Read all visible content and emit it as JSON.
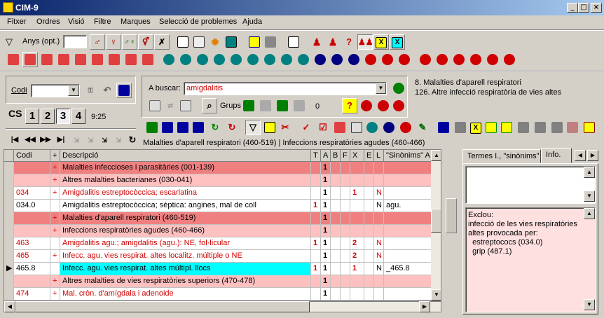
{
  "app": {
    "title": "CIM-9",
    "window_buttons": [
      "_",
      "□",
      "×"
    ]
  },
  "menu": [
    "Fitxer",
    "Ordres",
    "Visió",
    "Filtre",
    "Marques",
    "Selecció de problemes",
    "Ajuda"
  ],
  "filter": {
    "label": "Anys (opt.)",
    "value": ""
  },
  "codi": {
    "label": "Codi",
    "value": ""
  },
  "levels": [
    "CS",
    "1",
    "2",
    "3",
    "4"
  ],
  "time": "9:25",
  "search": {
    "label": "A buscar:",
    "value": "amigdalitis",
    "grups_label": "Grups",
    "count": "0"
  },
  "results": [
    "8. Malalties d'aparell respiratori",
    "126. Altre infecció respiratòria de vies altes"
  ],
  "breadcrumb": "Malalties d'aparell respiratori (460-519) | Infeccions respiratòries agudes (460-466)",
  "table": {
    "headers": [
      "Codi",
      "+",
      "Descripció",
      "T",
      "A",
      "B",
      "F",
      "X",
      "E",
      "L",
      "\"Sinònims\" A"
    ],
    "rows": [
      {
        "codi": "",
        "plus": "+",
        "desc": "Malalties infeccioses i parasitàries (001-139)",
        "T": "",
        "A": "1",
        "B": "",
        "F": "",
        "X": "",
        "E": "",
        "L": "",
        "syn": "",
        "style": "chapter"
      },
      {
        "codi": "",
        "plus": "+",
        "desc": "Altres malalties bacterianes (030-041)",
        "T": "",
        "A": "1",
        "B": "",
        "F": "",
        "X": "",
        "E": "",
        "L": "",
        "syn": "",
        "style": "group"
      },
      {
        "codi": "034",
        "plus": "+",
        "desc": "Amigdalitis estreptocòccica; escarlatina",
        "T": "",
        "A": "1",
        "B": "",
        "F": "",
        "X": "1",
        "E": "",
        "L": "N",
        "syn": "",
        "style": "redtext"
      },
      {
        "codi": "034.0",
        "plus": "",
        "desc": "Amigdalitis estreptocòccica; sèptica: angines, mal de coll",
        "T": "1",
        "A": "1",
        "B": "",
        "F": "",
        "X": "",
        "E": "",
        "L": "N",
        "syn": "agu.",
        "style": "plain"
      },
      {
        "codi": "",
        "plus": "+",
        "desc": "Malalties d'aparell respiratori (460-519)",
        "T": "",
        "A": "1",
        "B": "",
        "F": "",
        "X": "",
        "E": "",
        "L": "",
        "syn": "",
        "style": "chapter"
      },
      {
        "codi": "",
        "plus": "+",
        "desc": "Infeccions respiratòries agudes (460-466)",
        "T": "",
        "A": "1",
        "B": "",
        "F": "",
        "X": "",
        "E": "",
        "L": "",
        "syn": "",
        "style": "group"
      },
      {
        "codi": "463",
        "plus": "",
        "desc": "Amigdalitis agu.; amigdalitis (agu.): NE, fol·licular",
        "T": "1",
        "A": "1",
        "B": "",
        "F": "",
        "X": "2",
        "E": "",
        "L": "N",
        "syn": "",
        "style": "redtext"
      },
      {
        "codi": "465",
        "plus": "+",
        "desc": "Infecc. agu. vies respirat. altes localitz. múltiple o NE",
        "T": "",
        "A": "1",
        "B": "",
        "F": "",
        "X": "2",
        "E": "",
        "L": "N",
        "syn": "",
        "style": "redtext"
      },
      {
        "codi": "465.8",
        "plus": "",
        "desc": "Infecc. agu. vies respirat. altes múltipl. llocs",
        "T": "1",
        "A": "1",
        "B": "",
        "F": "",
        "X": "1",
        "E": "",
        "L": "N",
        "syn": "_465.8",
        "style": "selected"
      },
      {
        "codi": "",
        "plus": "+",
        "desc": "Altres malalties de vies respiratòries superiors (470-478)",
        "T": "",
        "A": "1",
        "B": "",
        "F": "",
        "X": "",
        "E": "",
        "L": "",
        "syn": "",
        "style": "group"
      },
      {
        "codi": "474",
        "plus": "+",
        "desc": "Mal. cròn. d'amígdala i adenoide",
        "T": "",
        "A": "1",
        "B": "",
        "F": "",
        "X": "",
        "E": "",
        "L": "",
        "syn": "",
        "style": "redtext"
      }
    ]
  },
  "tabs": [
    "Termes I., \"sinònims\"",
    "Info."
  ],
  "info_text": [
    "Exclou:",
    "infecció de les vies respiratòries",
    "altes provocada per:",
    "  estreptococs (034.0)",
    "  grip (487.1)"
  ],
  "colors": {
    "chapter": "#f08080",
    "group": "#ffc0c0",
    "selected": "#00ffff",
    "info_bg": "#ffe0e0",
    "title_a": "#0a246a",
    "title_b": "#a6caf0"
  }
}
